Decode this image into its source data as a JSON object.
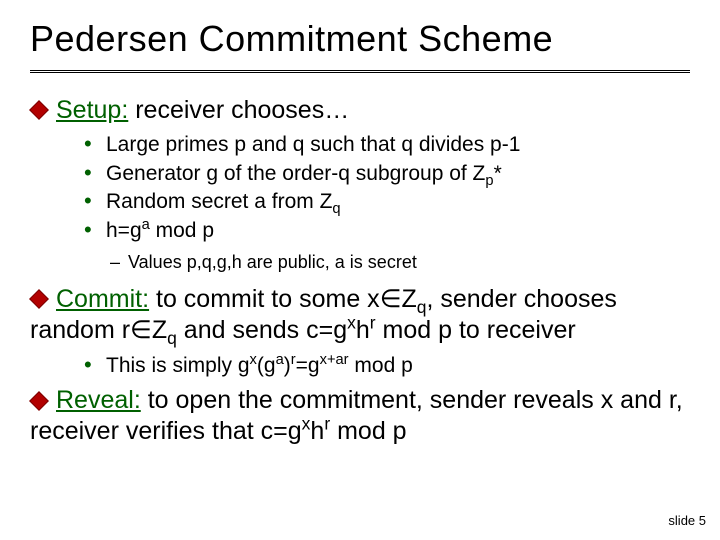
{
  "title": "Pedersen Commitment Scheme",
  "setup": {
    "label": "Setup:",
    "text": " receiver chooses…",
    "items": {
      "i1a": "Large primes p and q such that q divides p-1",
      "i2a": "Generator g of the order-q subgroup of Z",
      "i2b": "*",
      "i2sub": "p",
      "i3a": "Random secret a from Z",
      "i3sub": "q",
      "i4a": "h=g",
      "i4sup": "a",
      "i4b": " mod p"
    },
    "note": "Values p,q,g,h are public, a is secret"
  },
  "commit": {
    "label": "Commit:",
    "t1": " to commit to some x",
    "elem": "∈",
    "t2": "Z",
    "sub_q": "q",
    "t3": ", sender chooses random r",
    "t4": "Z",
    "t5": " and sends c=g",
    "sup_x": "x",
    "t6": "h",
    "sup_r": "r",
    "t7": " mod p to receiver",
    "note_a": "This is simply g",
    "note_b": "(g",
    "note_sup_a": "a",
    "note_c": ")",
    "note_d": "=g",
    "note_sup_xar": "x+ar",
    "note_e": " mod p"
  },
  "reveal": {
    "label": "Reveal:",
    "t1": " to open the commitment, sender reveals x and r, receiver verifies that c=g",
    "sup_x": "x",
    "t2": "h",
    "sup_r": "r",
    "t3": " mod p"
  },
  "footer": "slide 5"
}
